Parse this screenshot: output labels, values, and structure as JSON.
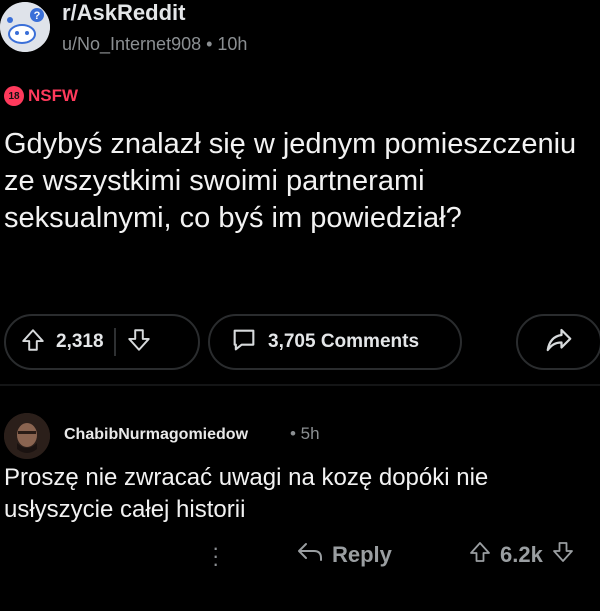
{
  "post": {
    "subreddit": "r/AskReddit",
    "author_time": "u/No_Internet908 • 10h",
    "nsfw_badge": "18",
    "nsfw_label": "NSFW",
    "title": "Gdybyś znalazł się w jednym pomieszczeniu ze wszystkimi swoimi partnerami seksualnymi, co byś im powiedział?",
    "score": "2,318",
    "comments": "3,705 Comments",
    "icons": {
      "upvote": "arrow-up-icon",
      "downvote": "arrow-down-icon",
      "comment": "comment-icon",
      "share": "share-icon"
    }
  },
  "comment": {
    "author": "ChabibNurmagomiedow",
    "time": "• 5h",
    "body": "Proszę nie zwracać uwagi na kozę dopóki nie usłyszycie całej historii",
    "reply_label": "Reply",
    "score": "6.2k"
  },
  "colors": {
    "background": "#000000",
    "nsfw": "#ff3a5c",
    "text": "#f2f2f2",
    "muted": "#8b8f92"
  }
}
